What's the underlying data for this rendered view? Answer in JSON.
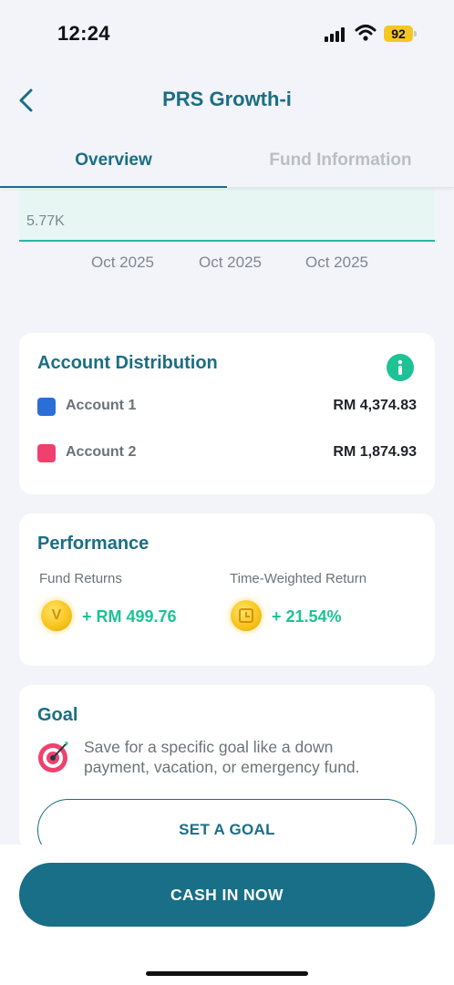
{
  "status_bar": {
    "time": "12:24",
    "battery": "92"
  },
  "header": {
    "title": "PRS Growth-i",
    "back_icon": "chevron-left-icon"
  },
  "tabs": [
    {
      "label": "Overview",
      "active": true
    },
    {
      "label": "Fund Information",
      "active": false
    }
  ],
  "chart": {
    "y_label": "5.77K",
    "x_ticks": [
      "Oct 2025",
      "Oct 2025",
      "Oct 2025"
    ],
    "line_color": "#2bb7a0"
  },
  "distribution": {
    "title": "Account Distribution",
    "info_icon": "info-icon",
    "accounts": [
      {
        "name": "Account 1",
        "value": "RM 4,374.83",
        "color": "#2a6fd6"
      },
      {
        "name": "Account 2",
        "value": "RM 1,874.93",
        "color": "#f0416e"
      }
    ]
  },
  "performance": {
    "title": "Performance",
    "fund_returns_label": "Fund Returns",
    "fund_returns_value": "+ RM 499.76",
    "twr_label": "Time-Weighted Return",
    "twr_value": "+ 21.54%"
  },
  "goal": {
    "title": "Goal",
    "description": "Save for a specific goal like a down payment, vacation, or emergency fund.",
    "button": "SET A GOAL"
  },
  "cta": {
    "label": "CASH IN NOW"
  },
  "colors": {
    "primary": "#1b6e84",
    "accent": "#1fc295",
    "background": "#f2f4f9"
  }
}
